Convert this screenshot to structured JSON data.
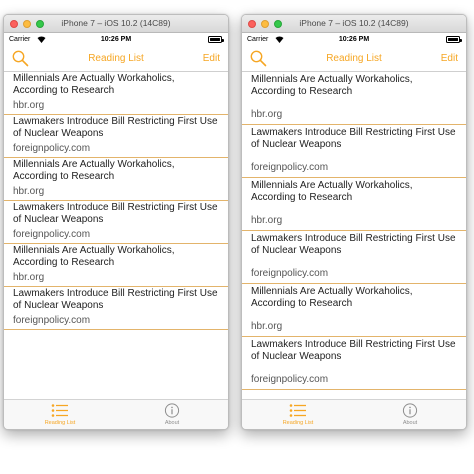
{
  "windows": [
    {
      "title": "iPhone 7 – iOS 10.2 (14C89)",
      "status": {
        "carrier": "Carrier",
        "time": "10:26 PM"
      },
      "nav": {
        "title": "Reading List",
        "edit": "Edit"
      },
      "items": [
        {
          "title": "Millennials Are Actually Workaholics, According to Research",
          "domain": "hbr.org"
        },
        {
          "title": "Lawmakers Introduce Bill Restricting First Use of Nuclear Weapons",
          "domain": "foreignpolicy.com"
        },
        {
          "title": "Millennials Are Actually Workaholics, According to Research",
          "domain": "hbr.org"
        },
        {
          "title": "Lawmakers Introduce Bill Restricting First Use of Nuclear Weapons",
          "domain": "foreignpolicy.com"
        },
        {
          "title": "Millennials Are Actually Workaholics, According to Research",
          "domain": "hbr.org"
        },
        {
          "title": "Lawmakers Introduce Bill Restricting First Use of Nuclear Weapons",
          "domain": "foreignpolicy.com"
        }
      ],
      "tabs": [
        {
          "label": "Reading List",
          "icon": "list-icon",
          "active": true
        },
        {
          "label": "About",
          "icon": "info-icon",
          "active": false
        }
      ]
    },
    {
      "title": "iPhone 7 – iOS 10.2 (14C89)",
      "status": {
        "carrier": "Carrier",
        "time": "10:26 PM"
      },
      "nav": {
        "title": "Reading List",
        "edit": "Edit"
      },
      "items": [
        {
          "title": "Millennials Are Actually Workaholics, According to Research",
          "domain": "hbr.org"
        },
        {
          "title": "Lawmakers Introduce Bill Restricting First Use of Nuclear Weapons",
          "domain": "foreignpolicy.com"
        },
        {
          "title": "Millennials Are Actually Workaholics, According to Research",
          "domain": "hbr.org"
        },
        {
          "title": "Lawmakers Introduce Bill Restricting First Use of Nuclear Weapons",
          "domain": "foreignpolicy.com"
        },
        {
          "title": "Millennials Are Actually Workaholics, According to Research",
          "domain": "hbr.org"
        },
        {
          "title": "Lawmakers Introduce Bill Restricting First Use of Nuclear Weapons",
          "domain": "foreignpolicy.com"
        }
      ],
      "tabs": [
        {
          "label": "Reading List",
          "icon": "list-icon",
          "active": true
        },
        {
          "label": "About",
          "icon": "info-icon",
          "active": false
        }
      ]
    }
  ],
  "colors": {
    "accent": "#f6a623",
    "separator": "#e3b46b",
    "inactive": "#8e8e8e"
  }
}
